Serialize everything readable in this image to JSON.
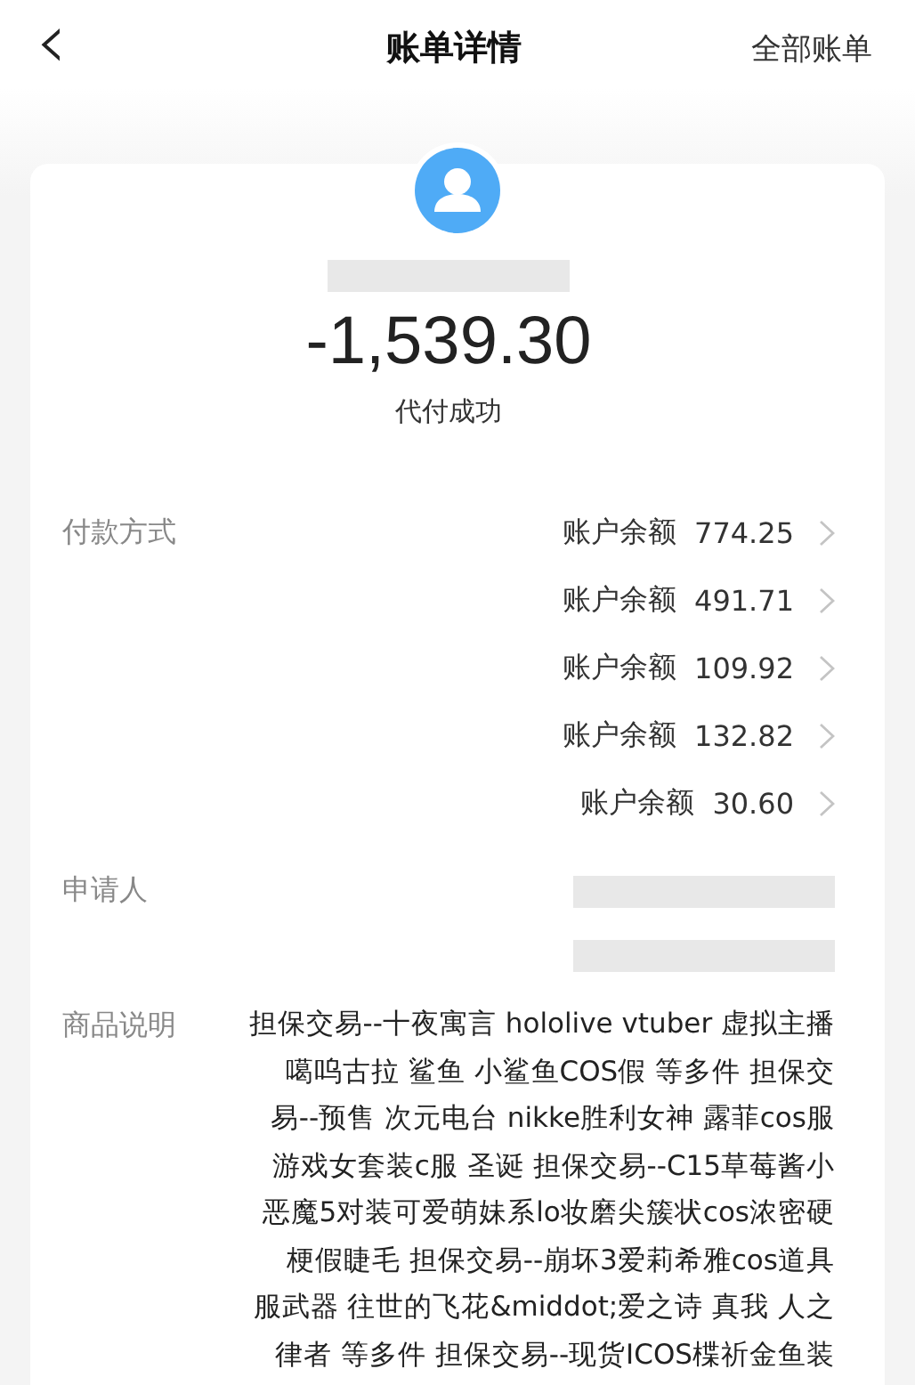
{
  "header": {
    "back_icon": "‹",
    "title": "账单详情",
    "action": "全部账单"
  },
  "summary": {
    "name_redacted": true,
    "amount": "-1,539.30",
    "status": "代付成功"
  },
  "payment": {
    "label": "付款方式",
    "methods": [
      {
        "name": "账户余额",
        "amount": "774.25"
      },
      {
        "name": "账户余额",
        "amount": "491.71"
      },
      {
        "name": "账户余额",
        "amount": "109.92"
      },
      {
        "name": "账户余额",
        "amount": "132.82"
      },
      {
        "name": "账户余额",
        "amount": "30.60"
      }
    ]
  },
  "applicant": {
    "label": "申请人",
    "value_redacted": true
  },
  "description": {
    "label": "商品说明",
    "lines": [
      "担保交易--十夜寓言 hololive vtuber 虚拟主播",
      "噶呜古拉 鲨鱼 小鲨鱼COS假 等多件 担保交",
      "易--预售 次元电台 nikke胜利女神 露菲cos服",
      "游戏女套装c服 圣诞 担保交易--C15草莓酱小",
      "恶魔5对装可爱萌妹系lo妆磨尖簇状cos浓密硬",
      "梗假睫毛 担保交易--崩坏3爱莉希雅cos道具",
      "服武器 往世的飞花&middot;爱之诗 真我 人之",
      "律者 等多件 担保交易--现货ICOS楪祈金鱼装"
    ]
  }
}
